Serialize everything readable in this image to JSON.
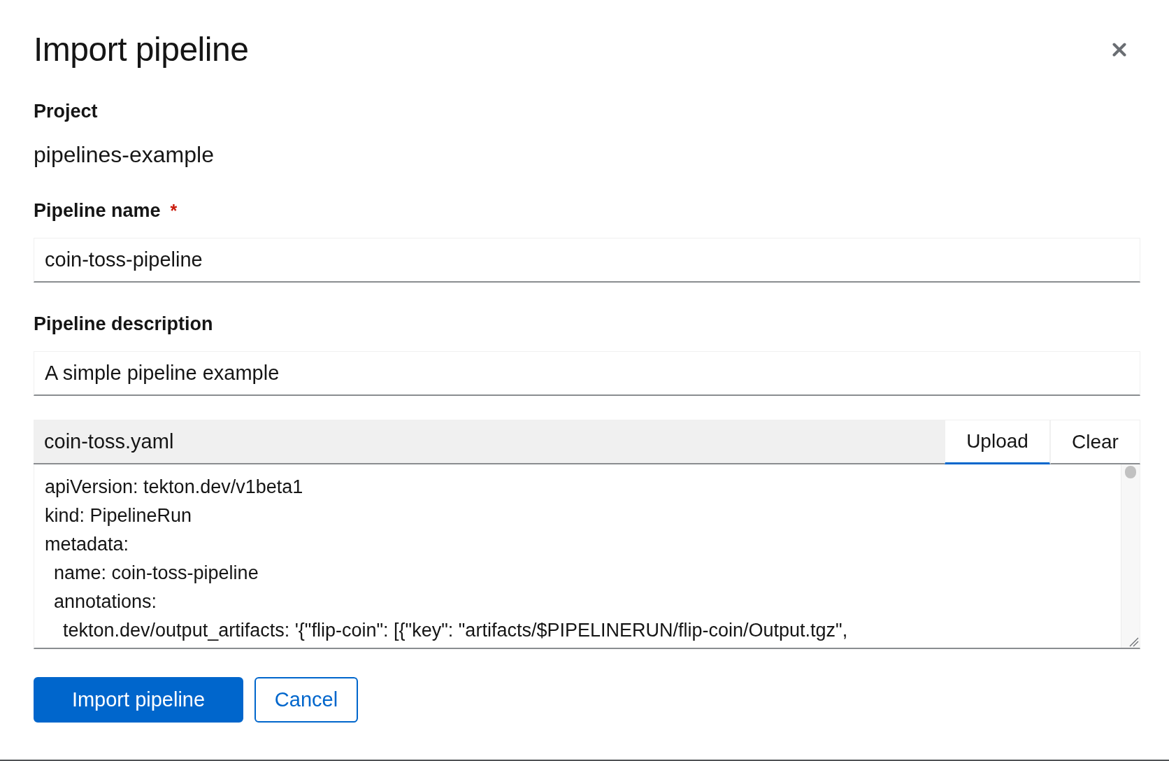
{
  "modal": {
    "title": "Import pipeline"
  },
  "project": {
    "label": "Project",
    "value": "pipelines-example"
  },
  "pipeline_name": {
    "label": "Pipeline name",
    "required_mark": "*",
    "value": "coin-toss-pipeline"
  },
  "pipeline_description": {
    "label": "Pipeline description",
    "value": "A simple pipeline example"
  },
  "file_upload": {
    "filename": "coin-toss.yaml",
    "buttons": [
      {
        "label": "Upload",
        "active": true
      },
      {
        "label": "Clear",
        "active": false
      }
    ],
    "content": [
      {
        "text": "apiVersion: tekton.dev/v1beta1"
      },
      {
        "text": "kind: PipelineRun"
      },
      {
        "text": "metadata:",
        "children": [
          {
            "text": "name: coin-toss-pipeline"
          },
          {
            "text": "annotations:",
            "children": [
              {
                "text": "tekton.dev/output_artifacts: '{\"flip-coin\": [{\"key\": \"artifacts/$PIPELINERUN/flip-coin/Output.tgz\","
              }
            ]
          }
        ]
      }
    ]
  },
  "actions": [
    {
      "label": "Import pipeline",
      "kind": "primary"
    },
    {
      "label": "Cancel",
      "kind": "secondary"
    }
  ]
}
